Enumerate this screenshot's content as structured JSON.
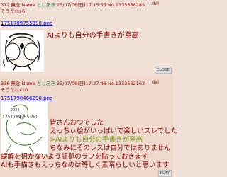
{
  "post1": {
    "number": "312",
    "nameword": "無念",
    "name_label": "Name",
    "name": "としあき",
    "date": "25/07/06(日)17:15:55",
    "no": "No.1333558785",
    "del": "del",
    "sodane": "そうだねx6",
    "file_link": "1751789755390.png",
    "comment": "AIよりも自分の手書きが至高",
    "close": "CLOSE"
  },
  "post2": {
    "number": "336",
    "nameword": "無念",
    "name_label": "Name",
    "name": "としあき",
    "date": "25/07/06(日)17:27:48",
    "no": "No.1333562163",
    "del": "del",
    "sodane": "そうだねx10",
    "file_link": "1751790466290.png",
    "lines": [
      "皆さんおつでした",
      "えっちぃ絵がいっぱいで楽しいスレでした",
      ">AIよりも自分の手書きが至高",
      "ちなみにそのレスは自分ではありません",
      "誤解を招かないよう証拠のラフを貼っておきます",
      "AIも手描きもえっちなのは等しく素晴らしいと思います"
    ],
    "play": "PLAY"
  }
}
